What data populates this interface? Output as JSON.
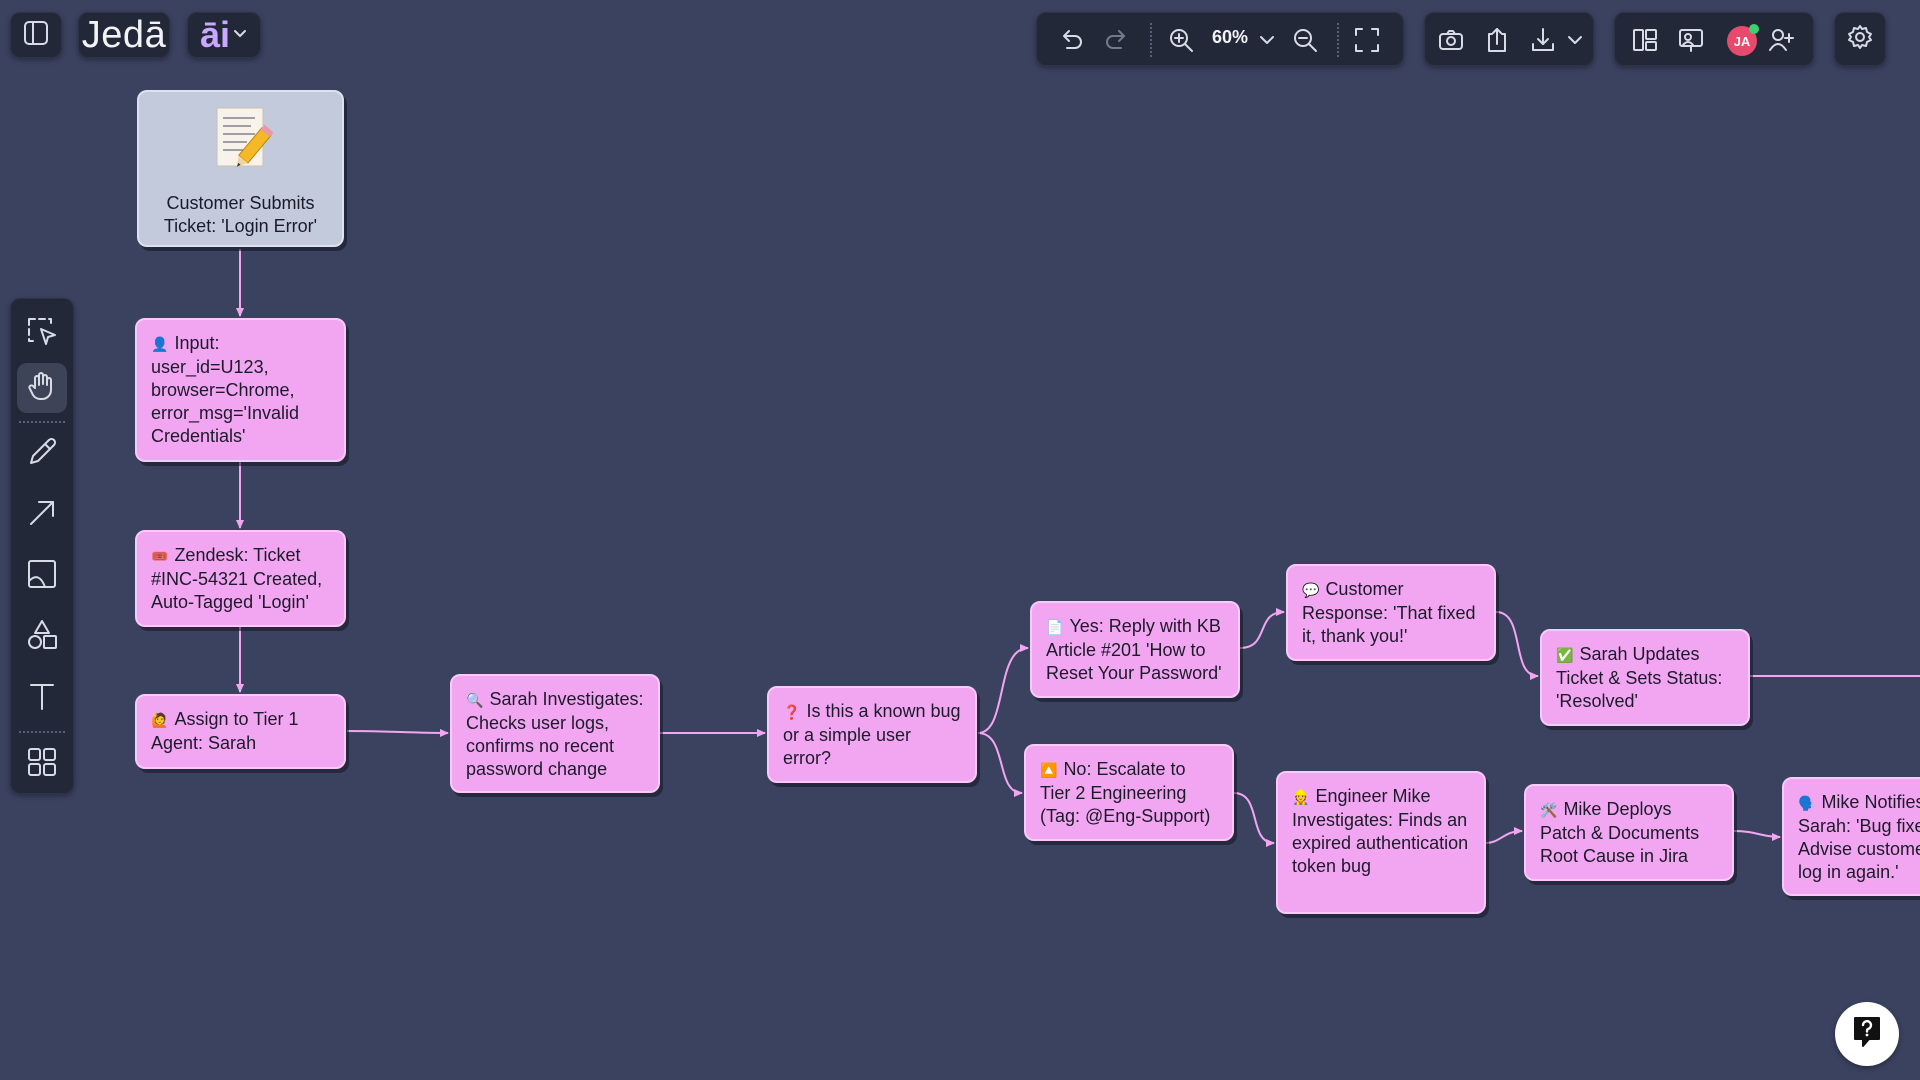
{
  "app": {
    "logo_text": "Jedā",
    "ai_text": "āi"
  },
  "toolbar": {
    "zoom_level": "60%",
    "avatar_initials": "JA"
  },
  "icons": {
    "sidebar_toggle": "sidebar-toggle-icon",
    "undo": "undo-icon",
    "redo": "redo-icon",
    "zoom_in": "zoom-in-icon",
    "zoom_out": "zoom-out-icon",
    "fit": "fit-screen-icon",
    "camera": "camera-icon",
    "upload": "upload-icon",
    "download": "download-icon",
    "layout": "layout-icon",
    "present": "present-icon",
    "invite": "add-user-icon",
    "settings": "gear-icon",
    "help": "help-icon"
  },
  "tools": [
    "select",
    "hand",
    "pencil",
    "arrow",
    "image",
    "shapes",
    "text",
    "templates"
  ],
  "flow": {
    "start": "Customer Submits Ticket: 'Login Error'",
    "input": "Input: user_id=U123, browser=Chrome, error_msg='Invalid Credentials'",
    "zendesk": "Zendesk: Ticket #INC-54321 Created, Auto-Tagged 'Login'",
    "assign": "Assign to Tier 1 Agent: Sarah",
    "investigate": "Sarah Investigates: Checks user logs, confirms no recent password change",
    "decision": "Is this a known bug or a simple user error?",
    "yes_reply": "Yes: Reply with KB Article #201 'How to Reset Your Password'",
    "customer_response": "Customer Response: 'That fixed it, thank you!'",
    "resolved": "Sarah Updates Ticket & Sets Status: 'Resolved'",
    "no_escalate": "No: Escalate to Tier 2 Engineering (Tag: @Eng-Support)",
    "engineer": "Engineer Mike Investigates: Finds an expired authentication token bug",
    "deploy": "Mike Deploys Patch & Documents Root Cause in Jira",
    "notify": "Mike Notifies Sarah: 'Bug fixed. Advise customer to log in again.'"
  },
  "emoji": {
    "input": "👤",
    "zendesk": "🎟️",
    "assign": "🙋",
    "investigate": "🔍",
    "decision": "❓",
    "yes_reply": "📄",
    "customer_response": "💬",
    "resolved": "✅",
    "no_escalate": "🔼",
    "engineer": "👷",
    "deploy": "🛠️",
    "notify": "🗣️"
  },
  "colors": {
    "canvas": "#3b4260",
    "node_fill": "#f2a6f1",
    "start_fill": "#c2cadb",
    "edge": "#f2a6f1"
  }
}
